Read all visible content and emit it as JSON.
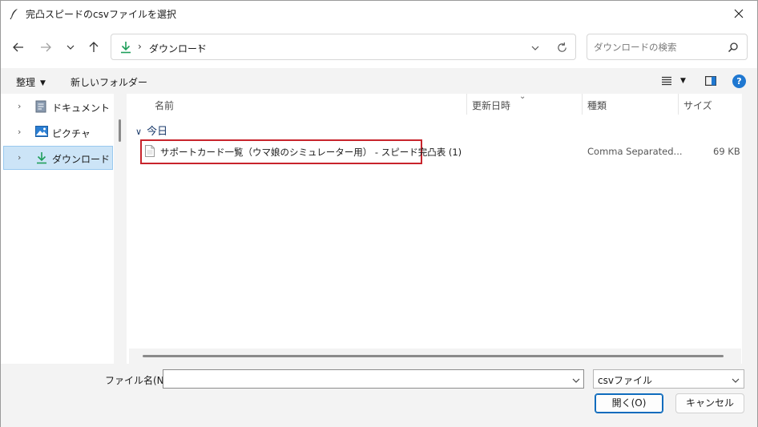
{
  "window": {
    "title": "完凸スピードのcsvファイルを選択"
  },
  "address": {
    "crumb": "ダウンロード",
    "separator": "›",
    "search_placeholder": "ダウンロードの検索"
  },
  "toolbar": {
    "organize_label": "整理",
    "new_folder_label": "新しいフォルダー",
    "help_label": "?"
  },
  "nav_pane": {
    "items": [
      {
        "label": "ドキュメント",
        "icon": "document-icon",
        "selected": false
      },
      {
        "label": "ピクチャ",
        "icon": "picture-icon",
        "selected": false
      },
      {
        "label": "ダウンロード",
        "icon": "download-icon",
        "selected": true
      }
    ]
  },
  "file_list": {
    "columns": [
      "名前",
      "更新日時",
      "種類",
      "サイズ"
    ],
    "group_label": "今日",
    "files": [
      {
        "name": "サポートカード一覧（ウマ娘のシミュレーター用） - スピード完凸表 (1)",
        "type": "Comma Separated...",
        "size": "69 KB"
      }
    ]
  },
  "bottom": {
    "filename_label": "ファイル名(N):",
    "filename_value": "",
    "filetype_value": "csvファイル",
    "open_label": "開く(O)",
    "cancel_label": "キャンセル"
  },
  "colors": {
    "accent": "#0f6cbd",
    "highlight_box": "#c8242c",
    "selection": "#cce4f7",
    "download_green": "#1e9e5a"
  }
}
